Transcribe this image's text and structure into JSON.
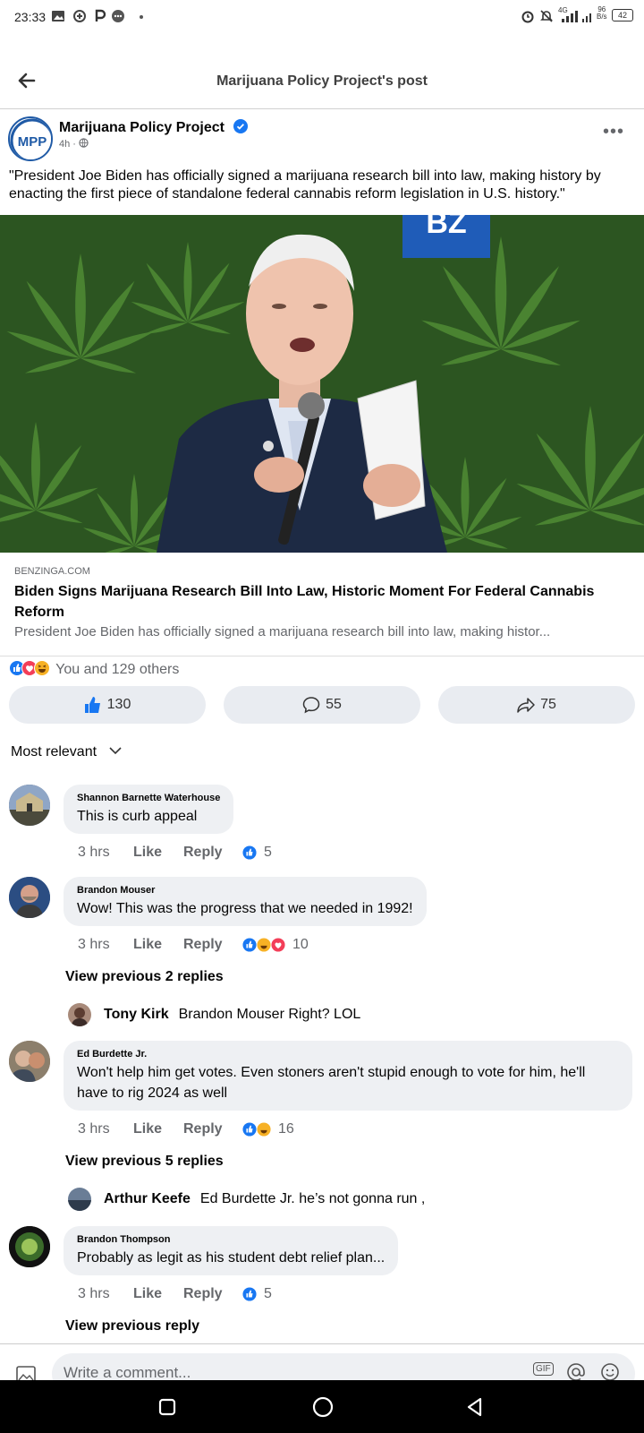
{
  "status_bar": {
    "time": "23:33",
    "speed_top": "96",
    "speed_bottom": "B/s",
    "battery": "42",
    "network": "4G"
  },
  "header": {
    "title": "Marijuana Policy Project's post"
  },
  "post": {
    "author": "Marijuana Policy Project",
    "avatar_text": "MPP",
    "time": "4h",
    "text": "\"President Joe Biden has officially signed a marijuana research bill into law, making history by enacting the first piece of standalone federal cannabis reform legislation in U.S. history.\"",
    "image_badge": "BZ",
    "link": {
      "domain": "BENZINGA.COM",
      "title": "Biden Signs Marijuana Research Bill Into Law, Historic Moment For Federal Cannabis Reform",
      "description": "President Joe Biden has officially signed a marijuana research bill into law, making histor..."
    },
    "reactions_summary": "You and 129 others",
    "like_count": "130",
    "comment_count": "55",
    "share_count": "75"
  },
  "sort_label": "Most relevant",
  "comments": [
    {
      "name": "Shannon Barnette Waterhouse",
      "text": "This is curb appeal",
      "time": "3 hrs",
      "like": "Like",
      "reply": "Reply",
      "count": "5"
    },
    {
      "name": "Brandon Mouser",
      "text": "Wow! This was the progress that we needed in 1992!",
      "time": "3 hrs",
      "like": "Like",
      "reply": "Reply",
      "count": "10",
      "view_replies": "View previous 2 replies",
      "reply_item": {
        "name": "Tony Kirk",
        "text": "Brandon Mouser Right? LOL"
      }
    },
    {
      "name": "Ed Burdette Jr.",
      "text": "Won't help him get votes. Even stoners aren't stupid enough to vote for him, he'll have to rig 2024 as well",
      "time": "3 hrs",
      "like": "Like",
      "reply": "Reply",
      "count": "16",
      "view_replies": "View previous 5 replies",
      "reply_item": {
        "name": "Arthur Keefe",
        "text": "Ed Burdette Jr. he’s not gonna run ,"
      }
    },
    {
      "name": "Brandon Thompson",
      "text": "Probably as legit as his student debt relief plan...",
      "time": "3 hrs",
      "like": "Like",
      "reply": "Reply",
      "count": "5",
      "view_replies": "View previous reply"
    }
  ],
  "composer": {
    "placeholder": "Write a comment...",
    "gif": "GIF"
  },
  "colors": {
    "facebook_blue": "#1877f2",
    "love_red": "#f33e58",
    "haha_yellow": "#f7b125",
    "bubble_bg": "#eef0f3",
    "pill_bg": "#e9ecf1"
  }
}
